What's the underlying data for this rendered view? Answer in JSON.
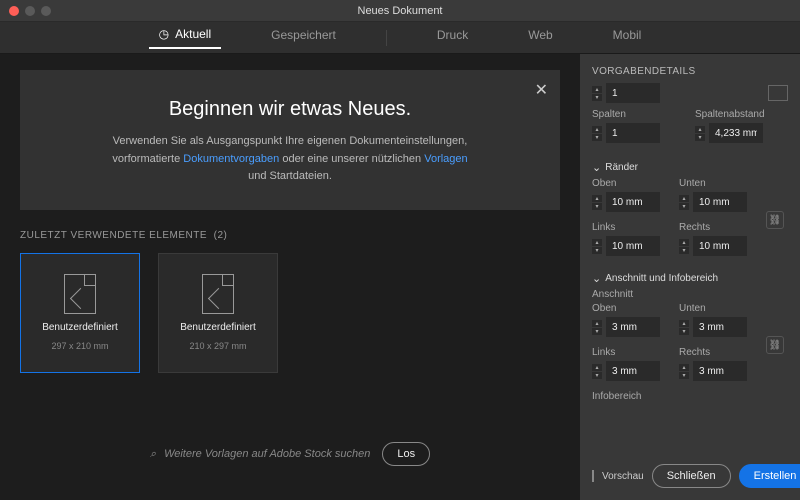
{
  "window": {
    "title": "Neues Dokument"
  },
  "tabs": {
    "aktuell": "Aktuell",
    "gespeichert": "Gespeichert",
    "druck": "Druck",
    "web": "Web",
    "mobil": "Mobil"
  },
  "hero": {
    "heading": "Beginnen wir etwas Neues.",
    "line1a": "Verwenden Sie als Ausgangspunkt Ihre eigenen Dokumenteinstellungen,",
    "line2a": "vorformatierte ",
    "link1": "Dokumentvorgaben",
    "line2b": " oder eine unserer nützlichen ",
    "link2": "Vorlagen",
    "line3": "und Startdateien."
  },
  "recent": {
    "label": "ZULETZT VERWENDETE ELEMENTE",
    "count": "(2)",
    "cards": [
      {
        "title": "Benutzerdefiniert",
        "sub": "297 x 210 mm"
      },
      {
        "title": "Benutzerdefiniert",
        "sub": "210 x 297 mm"
      }
    ]
  },
  "search": {
    "placeholder": "Weitere Vorlagen auf Adobe Stock suchen",
    "go": "Los"
  },
  "panel": {
    "title": "VORGABENDETAILS",
    "pages": "1",
    "spalten_lbl": "Spalten",
    "spalten": "1",
    "abstand_lbl": "Spaltenabstand",
    "abstand": "4,233 mm",
    "raender": "Ränder",
    "oben_lbl": "Oben",
    "oben": "10 mm",
    "unten_lbl": "Unten",
    "unten": "10 mm",
    "links_lbl": "Links",
    "links": "10 mm",
    "rechts_lbl": "Rechts",
    "rechts": "10 mm",
    "anschnitt": "Anschnitt und Infobereich",
    "anschnitt_lbl": "Anschnitt",
    "b_oben": "3 mm",
    "b_unten": "3 mm",
    "b_links": "3 mm",
    "b_rechts": "3 mm",
    "info_lbl": "Infobereich"
  },
  "footer": {
    "vorschau": "Vorschau",
    "schliessen": "Schließen",
    "erstellen": "Erstellen"
  }
}
